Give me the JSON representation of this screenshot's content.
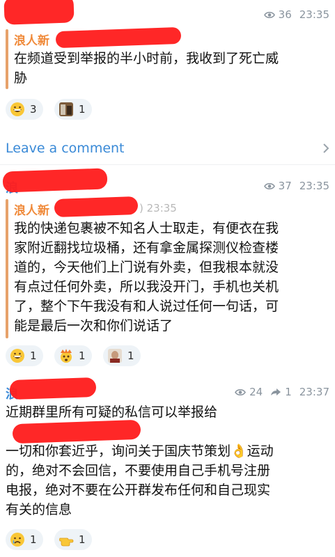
{
  "post1": {
    "views": "36",
    "time": "23:35",
    "quote_name": "浪人新",
    "message": "在频道受到举报的半小时前，我收到了死亡威\n胁",
    "reactions": [
      {
        "emoji": "grinning-face",
        "count": "3"
      },
      {
        "emoji": "photo-thumb",
        "count": "1"
      }
    ]
  },
  "comment": {
    "label": "Leave a comment"
  },
  "post2": {
    "name_fragment": "浪",
    "views": "37",
    "time": "23:35",
    "quote_name": "浪人新",
    "quote_time": ") 23:35",
    "message": "我的快递包裹被不知名人士取走，有便衣在我\n家附近翻找垃圾桶，还有拿金属探测仪检查楼\n道的，今天他们上门说有外卖，但我根本就没\n有点过任何外卖，所以我没开门，手机也关机\n了，整个下午我没有和人说过任何一句话，可\n能是最后一次和你们说话了",
    "reactions": [
      {
        "emoji": "grinning-face",
        "count": "1"
      },
      {
        "emoji": "exploding-head",
        "count": "1"
      },
      {
        "emoji": "photo-thumb",
        "count": "1"
      }
    ]
  },
  "post3": {
    "name_fragment": "浪",
    "views": "24",
    "shares": "1",
    "time": "23:37",
    "line1": "近期群里所有可疑的私信可以举报给",
    "message": "一切和你套近乎，询问关于国庆节策划👌运动\n的，绝对不会回信，不要使用自己手机号注册\n电报，绝对不要在公开群发布任何和自己现实\n有关的信息",
    "reactions": [
      {
        "emoji": "crying-face",
        "count": "1"
      },
      {
        "emoji": "pointing-hand",
        "count": "1"
      }
    ]
  },
  "colors": {
    "accent": "#3a8ad7",
    "quote_bar": "#e7a26b",
    "quote_name": "#f08a3a",
    "redaction": "#ff1e1e"
  }
}
